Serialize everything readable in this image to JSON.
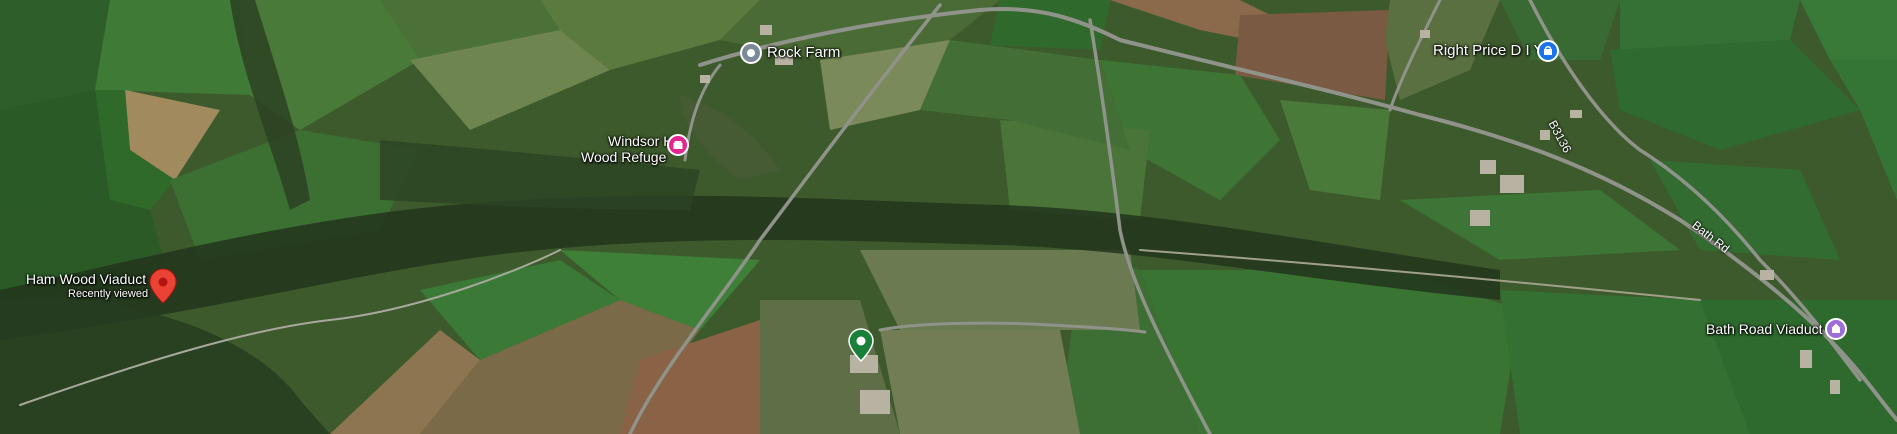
{
  "map": {
    "view": "satellite",
    "places": [
      {
        "name": "Rock Farm",
        "kind": "generic",
        "color": "#7b8a99"
      },
      {
        "name": "Right Price D I Y",
        "kind": "shopping",
        "color": "#1a73e8"
      },
      {
        "name_line1": "Windsor Hill",
        "name_line2": "Wood Refuge",
        "kind": "landmark",
        "color": "#e52592"
      },
      {
        "name": "Ham Wood Viaduct",
        "sub": "Recently viewed",
        "kind": "selected-pin",
        "color": "#ea4335"
      },
      {
        "name": "Bath Road Viaduct",
        "kind": "landmark",
        "color": "#9b6ed8"
      },
      {
        "name": "",
        "kind": "park",
        "color": "#188038"
      }
    ],
    "roads": [
      "B3136",
      "Bath Rd"
    ]
  }
}
